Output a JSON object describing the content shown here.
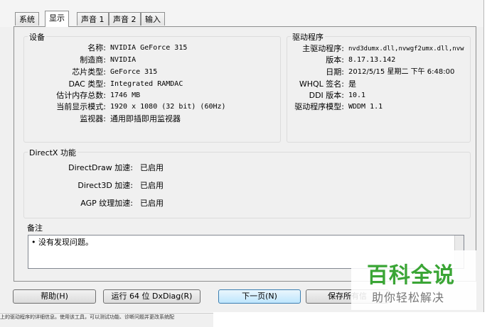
{
  "tabs": [
    "系统",
    "显示",
    "声音 1",
    "声音 2",
    "输入"
  ],
  "device": {
    "title": "设备",
    "rows": [
      {
        "label": "名称:",
        "value": "NVIDIA GeForce 315"
      },
      {
        "label": "制造商:",
        "value": "NVIDIA"
      },
      {
        "label": "芯片类型:",
        "value": "GeForce 315"
      },
      {
        "label": "DAC 类型:",
        "value": "Integrated RAMDAC"
      },
      {
        "label": "估计内存总数:",
        "value": "1746 MB"
      },
      {
        "label": "当前显示模式:",
        "value": "1920 x 1080 (32 bit) (60Hz)"
      },
      {
        "label": "监视器:",
        "value": "通用即插即用监视器"
      }
    ]
  },
  "driver": {
    "title": "驱动程序",
    "rows": [
      {
        "label": "主驱动程序:",
        "value": "nvd3dumx.dll,nvwgf2umx.dll,nvw"
      },
      {
        "label": "版本:",
        "value": "8.17.13.142"
      },
      {
        "label": "日期:",
        "value": "2012/5/15 星期二 下午 6:48:00"
      },
      {
        "label": "WHQL 签名:",
        "value": "是"
      },
      {
        "label": "DDI 版本:",
        "value": "10.1"
      },
      {
        "label": "驱动程序模型:",
        "value": "WDDM 1.1"
      }
    ]
  },
  "directx": {
    "title": "DirectX 功能",
    "rows": [
      {
        "label": "DirectDraw 加速:",
        "value": "已启用"
      },
      {
        "label": "Direct3D 加速:",
        "value": "已启用"
      },
      {
        "label": "AGP 纹理加速:",
        "value": "已启用"
      }
    ]
  },
  "notes": {
    "title": "备注",
    "lines": [
      "•   没有发现问题。"
    ]
  },
  "buttons": {
    "help": "帮助(H)",
    "run64": "运行 64 位 DxDiag(R)",
    "next": "下一页(N)",
    "save": "保存所有信"
  },
  "status": "上的驱动程序的详细信息。使用该工具，可以测试功能、诊断问题并更改系统配",
  "watermark": {
    "title": "百科全说",
    "subtitle": "助你轻松解决"
  }
}
